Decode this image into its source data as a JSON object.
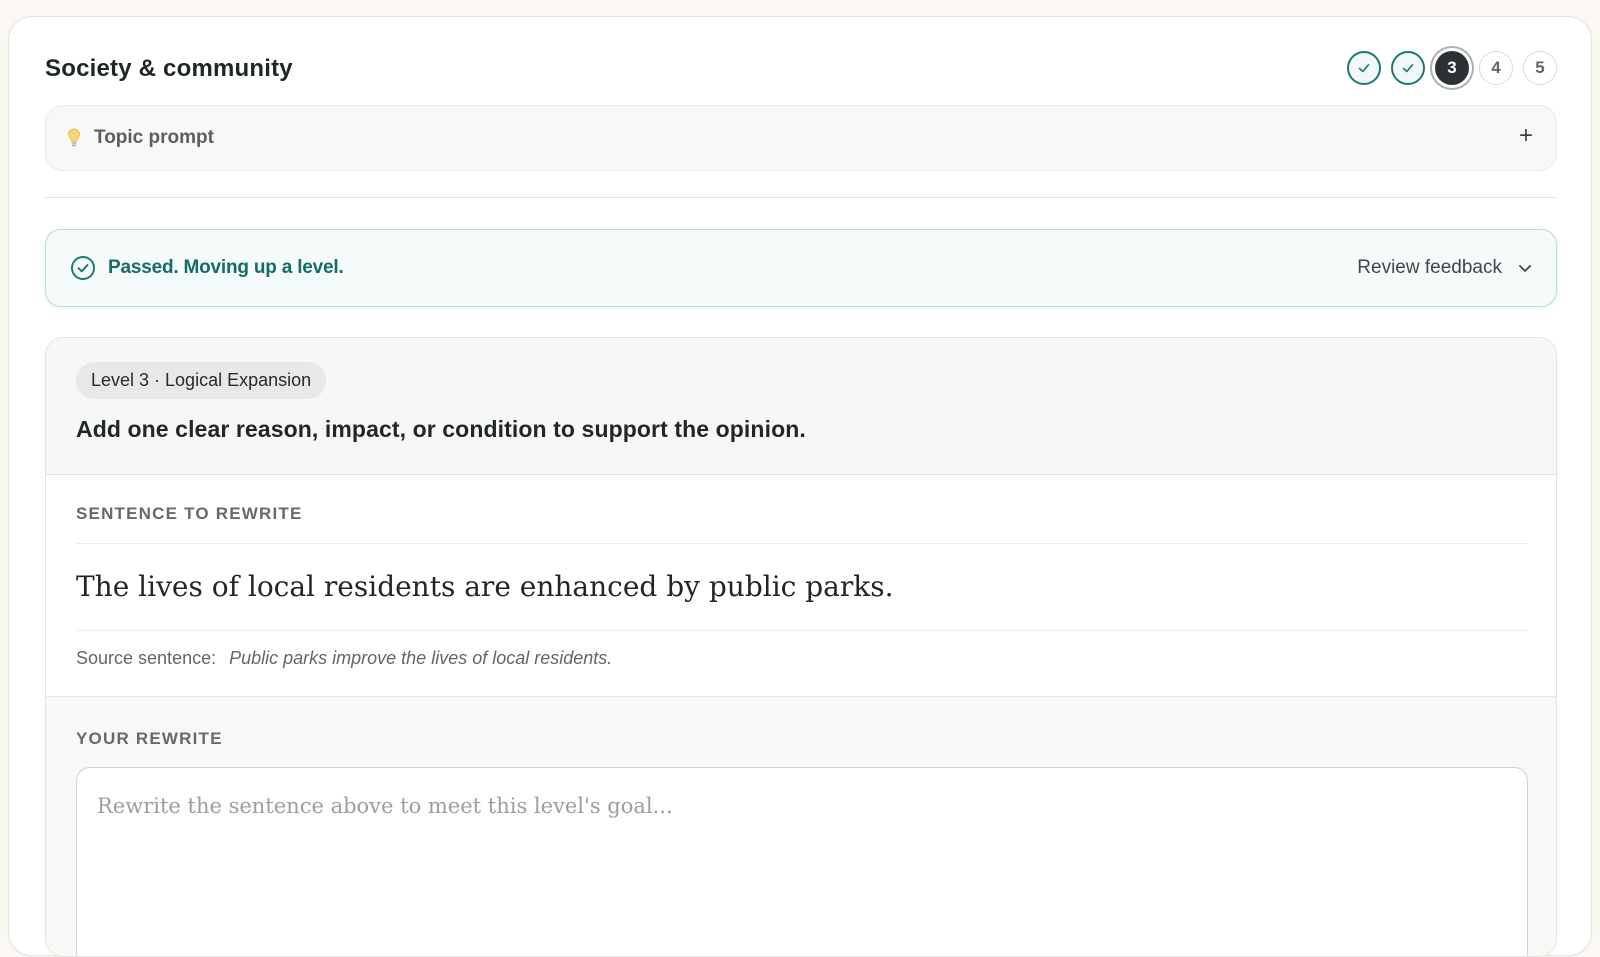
{
  "header": {
    "title": "Society & community"
  },
  "steps": [
    {
      "label": "",
      "state": "done",
      "icon": "check-icon"
    },
    {
      "label": "",
      "state": "done",
      "icon": "check-icon"
    },
    {
      "label": "3",
      "state": "current"
    },
    {
      "label": "4",
      "state": "todo"
    },
    {
      "label": "5",
      "state": "todo"
    }
  ],
  "topic": {
    "icon": "lightbulb-icon",
    "label": "Topic prompt",
    "toggle": "+"
  },
  "status": {
    "icon": "check-circle-icon",
    "message": "Passed. Moving up a level.",
    "review_label": "Review feedback",
    "review_icon": "chevron-down-icon",
    "color": "#176b66"
  },
  "level": {
    "badge": "Level 3 · Logical Expansion",
    "goal": "Add one clear reason, impact, or condition to support the opinion."
  },
  "sentence_section": {
    "label": "SENTENCE TO REWRITE",
    "sentence": "The lives of local residents are enhanced by public parks.",
    "source_label": "Source sentence:",
    "source_text": "Public parks improve the lives of local residents."
  },
  "rewrite": {
    "label": "YOUR REWRITE",
    "placeholder": "Rewrite the sentence above to meet this level's goal...",
    "value": ""
  },
  "colors": {
    "accent": "#1c7a74",
    "current_step": "#2a3234",
    "background": "#fbf8f3"
  }
}
